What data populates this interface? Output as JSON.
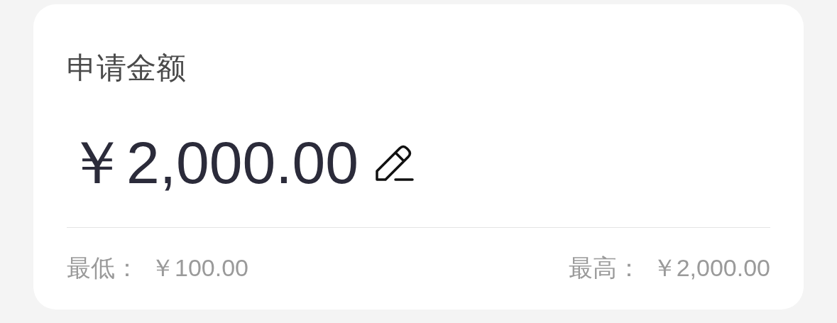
{
  "title": "申请金额",
  "amount": "￥2,000.00",
  "limits": [
    {
      "label": "最低：",
      "value": "￥100.00"
    },
    {
      "label": "最高：",
      "value": "￥2,000.00"
    }
  ]
}
